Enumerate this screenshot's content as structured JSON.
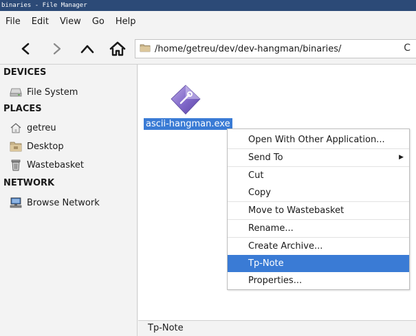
{
  "window": {
    "title": "binaries - File Manager"
  },
  "menubar": {
    "items": [
      "File",
      "Edit",
      "View",
      "Go",
      "Help"
    ]
  },
  "toolbar": {
    "back_icon": "chevron-left-icon",
    "forward_icon": "chevron-right-icon",
    "up_icon": "chevron-up-icon",
    "home_icon": "home-icon",
    "location": "/home/getreu/dev/dev-hangman/binaries/",
    "reload_glyph": "C"
  },
  "sidebar": {
    "devices_header": "DEVICES",
    "devices": [
      {
        "label": "File System",
        "icon": "drive-icon"
      }
    ],
    "places_header": "PLACES",
    "places": [
      {
        "label": "getreu",
        "icon": "home-folder-icon"
      },
      {
        "label": "Desktop",
        "icon": "desktop-folder-icon"
      },
      {
        "label": "Wastebasket",
        "icon": "trash-icon"
      }
    ],
    "network_header": "NETWORK",
    "network": [
      {
        "label": "Browse Network",
        "icon": "network-icon"
      }
    ]
  },
  "content": {
    "files": [
      {
        "name": "ascii-hangman.exe",
        "icon": "executable-icon",
        "selected": true
      }
    ]
  },
  "context_menu": {
    "items": [
      {
        "label": "Open With Other Application...",
        "active": false
      },
      {
        "label": "Send To",
        "active": false,
        "submenu": true
      },
      {
        "label": "Cut",
        "active": false
      },
      {
        "label": "Copy",
        "active": false
      },
      {
        "label": "Move to Wastebasket",
        "active": false
      },
      {
        "label": "Rename...",
        "active": false
      },
      {
        "label": "Create Archive...",
        "active": false
      },
      {
        "label": "Tp-Note",
        "active": true
      },
      {
        "label": "Properties...",
        "active": false
      }
    ]
  },
  "statusbar": {
    "text": "Tp-Note"
  },
  "colors": {
    "titlebar": "#2c4a77",
    "selection": "#3a7bd5"
  }
}
